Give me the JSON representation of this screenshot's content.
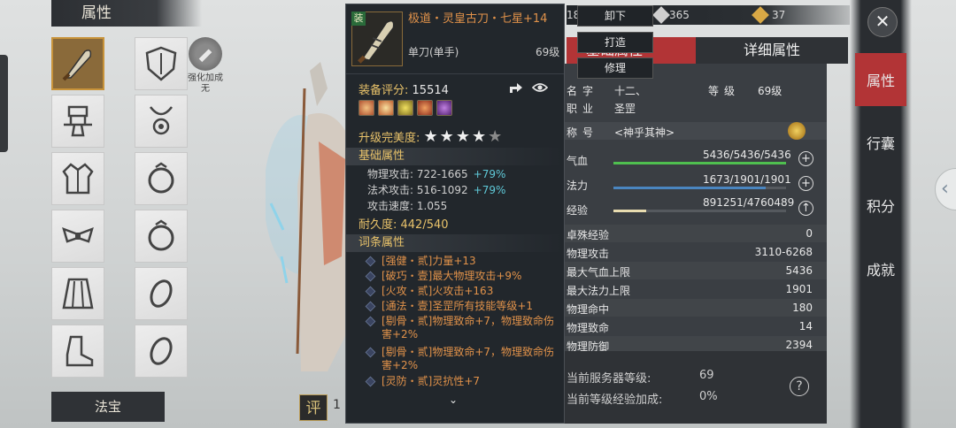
{
  "left_panel": {
    "title": "属性",
    "enhance_label": "强化加成",
    "enhance_value": "无",
    "fabao_label": "法宝",
    "score_badge": "评",
    "score_num": "1",
    "slots": [
      "weapon",
      "helmet",
      "armor-top",
      "necklace",
      "robe",
      "ring",
      "belt",
      "ring2",
      "pants",
      "bracelet",
      "boots",
      "bracelet2"
    ]
  },
  "tooltip": {
    "badge": "装",
    "name": "极道・灵皇古刀・七星+14",
    "type": "单刀(单手)",
    "level": "69级",
    "score_label": "装备评分:",
    "score_value": "15514",
    "upgrade_label": "升级完美度:",
    "stars": 5,
    "stars_filled": 4,
    "base_title": "基础属性",
    "base_rows": [
      {
        "label": "物理攻击:",
        "value": "722-1665",
        "plus": "+79%"
      },
      {
        "label": "法术攻击:",
        "value": "516-1092",
        "plus": "+79%"
      },
      {
        "label": "攻击速度:",
        "value": "1.055",
        "plus": ""
      }
    ],
    "durability": "耐久度: 442/540",
    "affix_title": "词条属性",
    "affixes": [
      "[强健・贰]力量+13",
      "[破巧・壹]最大物理攻击+9%",
      "[火攻・贰]火攻击+163",
      "[通法・壹]圣罡所有技能等级+1",
      "[剔骨・贰]物理致命+7，物理致命伤害+2%",
      "[剔骨・贰]物理致命+7，物理致命伤害+2%",
      "[灵防・贰]灵抗性+7"
    ],
    "more_icon": "chevron-down-icon"
  },
  "buttons": {
    "unequip": "卸下",
    "forge": "打造",
    "repair": "修理"
  },
  "topbar": {
    "first": "18",
    "silver": "365",
    "gold": "37"
  },
  "stats": {
    "tab_left": "基础属性",
    "tab_right": "详细属性",
    "name_label": "名字",
    "name_value": "十二、",
    "level_label": "等级",
    "level_value": "69级",
    "job_label": "职业",
    "job_value": "圣罡",
    "title_label": "称号",
    "title_value": "<神乎其神>",
    "hp_label": "气血",
    "hp_value": "5436/5436/5436",
    "hp_fill": 1.0,
    "mp_label": "法力",
    "mp_value": "1673/1901/1901",
    "mp_fill": 0.88,
    "exp_label": "经验",
    "exp_value": "891251/4760489",
    "exp_fill": 0.19,
    "rows": [
      {
        "label": "卓殊经验",
        "value": "0"
      },
      {
        "label": "物理攻击",
        "value": "3110-6268"
      },
      {
        "label": "最大气血上限",
        "value": "5436"
      },
      {
        "label": "最大法力上限",
        "value": "1901"
      },
      {
        "label": "物理命中",
        "value": "180"
      },
      {
        "label": "物理致命",
        "value": "14"
      },
      {
        "label": "物理防御",
        "value": "2394"
      }
    ],
    "server_level_label": "当前服务器等级:",
    "server_level_value": "69",
    "exp_bonus_label": "当前等级经验加成:",
    "exp_bonus_value": "0%"
  },
  "right_menu": {
    "close_icon": "close-icon",
    "items": [
      "属性",
      "行囊",
      "积分",
      "成就"
    ]
  },
  "colors": {
    "accent_red": "#b23436",
    "gold_text": "#e8c26a",
    "orange_text": "#e1924a",
    "cyan_text": "#5fc9d8"
  }
}
